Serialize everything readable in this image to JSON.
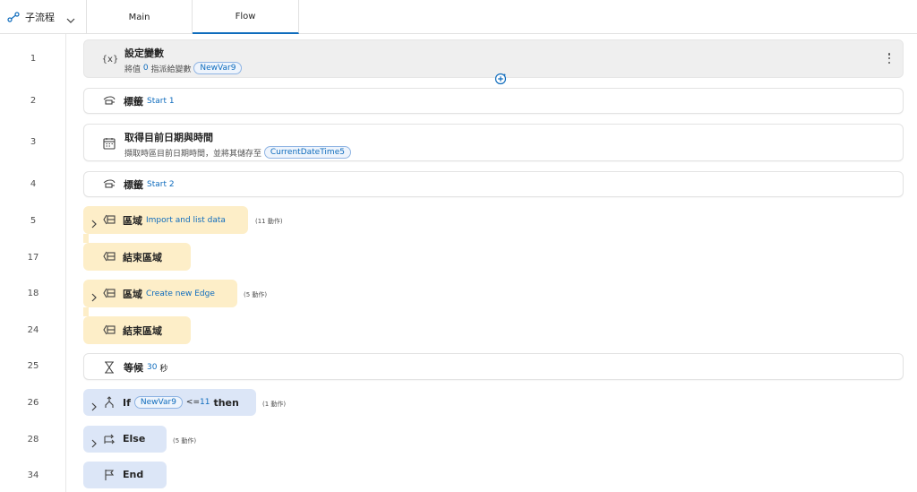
{
  "header": {
    "subflows_label": "子流程",
    "tabs": [
      {
        "label": "Main",
        "active": false
      },
      {
        "label": "Flow",
        "active": true
      }
    ]
  },
  "colors": {
    "accent": "#0f6cbd",
    "region_bg": "#fdeec8",
    "condition_bg": "#dce6f7",
    "selected_bg": "#efefef"
  },
  "steps": [
    {
      "line": "1",
      "icon": "variable-icon",
      "icon_text": "{x}",
      "title": "設定變數",
      "sub_prefix": "將值",
      "sub_value": "0",
      "sub_middle": "指派給變數",
      "sub_pill": "NewVar9"
    },
    {
      "line": "2",
      "icon": "label-icon",
      "title": "標籤",
      "link": "Start 1"
    },
    {
      "line": "3",
      "icon": "calendar-icon",
      "title": "取得目前日期與時間",
      "sub_text": "擷取時區目前日期時間，並將其儲存至",
      "sub_pill": "CurrentDateTime5"
    },
    {
      "line": "4",
      "icon": "label-icon",
      "title": "標籤",
      "link": "Start 2"
    },
    {
      "line": "5",
      "icon": "region-icon",
      "title": "區域",
      "link": "Import and list data",
      "count": "(11 動作)"
    },
    {
      "line": "17",
      "icon": "region-icon",
      "title": "結束區域"
    },
    {
      "line": "18",
      "icon": "region-icon",
      "title": "區域",
      "link": "Create new Edge",
      "count": "(5 動作)"
    },
    {
      "line": "24",
      "icon": "region-icon",
      "title": "結束區域"
    },
    {
      "line": "25",
      "icon": "hourglass-icon",
      "title": "等候",
      "value": "30",
      "unit": "秒"
    },
    {
      "line": "26",
      "icon": "if-icon",
      "title": "If",
      "pill": "NewVar9",
      "operator": "<=",
      "operand": "11",
      "then_kw": "then",
      "count": "(1 動作)"
    },
    {
      "line": "28",
      "icon": "else-icon",
      "title": "Else",
      "count": "(5 動作)"
    },
    {
      "line": "34",
      "icon": "flag-icon",
      "title": "End"
    }
  ]
}
